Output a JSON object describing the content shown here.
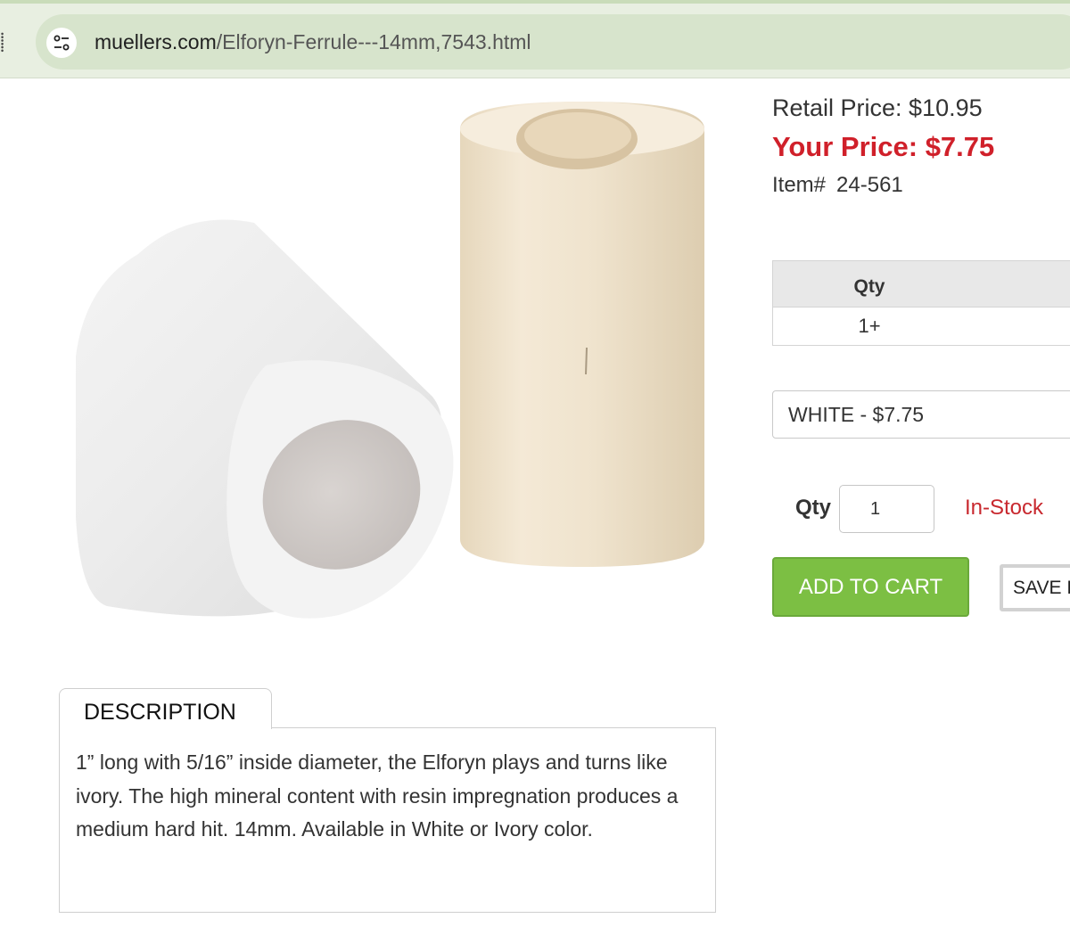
{
  "browser": {
    "url_host": "muellers.com",
    "url_path": "/Elforyn-Ferrule---14mm,7543.html",
    "site_info_icon": "tune-icon"
  },
  "product": {
    "image_alt": "Elforyn ferrules",
    "retail_price": "Retail Price: $10.95",
    "your_price": "Your Price: $7.75",
    "item_label": "Item#",
    "item_number": "24-561"
  },
  "pricing_table": {
    "header": "Qty",
    "row": "1+"
  },
  "variant": {
    "selected": "WHITE - $7.75"
  },
  "purchase": {
    "qty_label": "Qty",
    "qty_value": "1",
    "stock_status": "In-Stock",
    "add_to_cart": "ADD TO CART",
    "save": "SAVE I"
  },
  "description": {
    "tab_label": "DESCRIPTION",
    "text": "1” long with 5/16” inside diameter, the Elforyn plays and turns like ivory. The high mineral content with resin impregnation produces a medium hard hit. 14mm. Available in White or Ivory color."
  },
  "colors": {
    "chrome_bg": "#e8efe1",
    "price_red": "#d0202a",
    "cart_green": "#7cbf43",
    "white_ferrule": "#eeeeee",
    "ivory_ferrule": "#efe3cd"
  }
}
